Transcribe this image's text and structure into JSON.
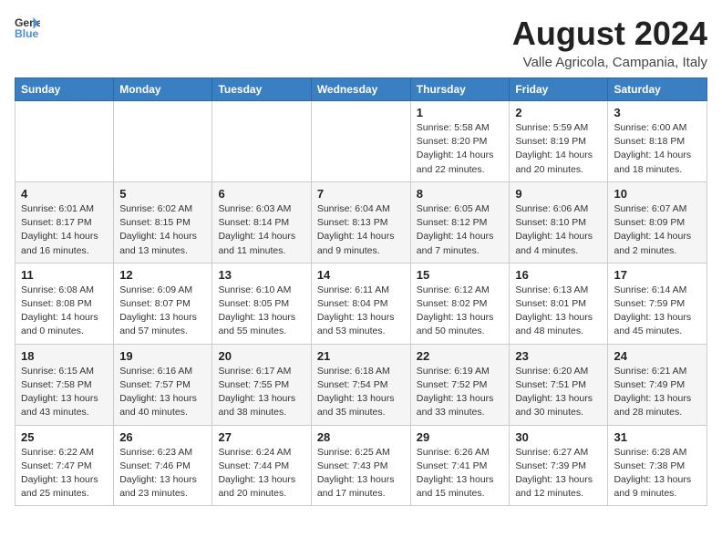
{
  "logo": {
    "line1": "General",
    "line2": "Blue"
  },
  "title": "August 2024",
  "location": "Valle Agricola, Campania, Italy",
  "days_of_week": [
    "Sunday",
    "Monday",
    "Tuesday",
    "Wednesday",
    "Thursday",
    "Friday",
    "Saturday"
  ],
  "weeks": [
    [
      {
        "day": "",
        "info": ""
      },
      {
        "day": "",
        "info": ""
      },
      {
        "day": "",
        "info": ""
      },
      {
        "day": "",
        "info": ""
      },
      {
        "day": "1",
        "info": "Sunrise: 5:58 AM\nSunset: 8:20 PM\nDaylight: 14 hours\nand 22 minutes."
      },
      {
        "day": "2",
        "info": "Sunrise: 5:59 AM\nSunset: 8:19 PM\nDaylight: 14 hours\nand 20 minutes."
      },
      {
        "day": "3",
        "info": "Sunrise: 6:00 AM\nSunset: 8:18 PM\nDaylight: 14 hours\nand 18 minutes."
      }
    ],
    [
      {
        "day": "4",
        "info": "Sunrise: 6:01 AM\nSunset: 8:17 PM\nDaylight: 14 hours\nand 16 minutes."
      },
      {
        "day": "5",
        "info": "Sunrise: 6:02 AM\nSunset: 8:15 PM\nDaylight: 14 hours\nand 13 minutes."
      },
      {
        "day": "6",
        "info": "Sunrise: 6:03 AM\nSunset: 8:14 PM\nDaylight: 14 hours\nand 11 minutes."
      },
      {
        "day": "7",
        "info": "Sunrise: 6:04 AM\nSunset: 8:13 PM\nDaylight: 14 hours\nand 9 minutes."
      },
      {
        "day": "8",
        "info": "Sunrise: 6:05 AM\nSunset: 8:12 PM\nDaylight: 14 hours\nand 7 minutes."
      },
      {
        "day": "9",
        "info": "Sunrise: 6:06 AM\nSunset: 8:10 PM\nDaylight: 14 hours\nand 4 minutes."
      },
      {
        "day": "10",
        "info": "Sunrise: 6:07 AM\nSunset: 8:09 PM\nDaylight: 14 hours\nand 2 minutes."
      }
    ],
    [
      {
        "day": "11",
        "info": "Sunrise: 6:08 AM\nSunset: 8:08 PM\nDaylight: 14 hours\nand 0 minutes."
      },
      {
        "day": "12",
        "info": "Sunrise: 6:09 AM\nSunset: 8:07 PM\nDaylight: 13 hours\nand 57 minutes."
      },
      {
        "day": "13",
        "info": "Sunrise: 6:10 AM\nSunset: 8:05 PM\nDaylight: 13 hours\nand 55 minutes."
      },
      {
        "day": "14",
        "info": "Sunrise: 6:11 AM\nSunset: 8:04 PM\nDaylight: 13 hours\nand 53 minutes."
      },
      {
        "day": "15",
        "info": "Sunrise: 6:12 AM\nSunset: 8:02 PM\nDaylight: 13 hours\nand 50 minutes."
      },
      {
        "day": "16",
        "info": "Sunrise: 6:13 AM\nSunset: 8:01 PM\nDaylight: 13 hours\nand 48 minutes."
      },
      {
        "day": "17",
        "info": "Sunrise: 6:14 AM\nSunset: 7:59 PM\nDaylight: 13 hours\nand 45 minutes."
      }
    ],
    [
      {
        "day": "18",
        "info": "Sunrise: 6:15 AM\nSunset: 7:58 PM\nDaylight: 13 hours\nand 43 minutes."
      },
      {
        "day": "19",
        "info": "Sunrise: 6:16 AM\nSunset: 7:57 PM\nDaylight: 13 hours\nand 40 minutes."
      },
      {
        "day": "20",
        "info": "Sunrise: 6:17 AM\nSunset: 7:55 PM\nDaylight: 13 hours\nand 38 minutes."
      },
      {
        "day": "21",
        "info": "Sunrise: 6:18 AM\nSunset: 7:54 PM\nDaylight: 13 hours\nand 35 minutes."
      },
      {
        "day": "22",
        "info": "Sunrise: 6:19 AM\nSunset: 7:52 PM\nDaylight: 13 hours\nand 33 minutes."
      },
      {
        "day": "23",
        "info": "Sunrise: 6:20 AM\nSunset: 7:51 PM\nDaylight: 13 hours\nand 30 minutes."
      },
      {
        "day": "24",
        "info": "Sunrise: 6:21 AM\nSunset: 7:49 PM\nDaylight: 13 hours\nand 28 minutes."
      }
    ],
    [
      {
        "day": "25",
        "info": "Sunrise: 6:22 AM\nSunset: 7:47 PM\nDaylight: 13 hours\nand 25 minutes."
      },
      {
        "day": "26",
        "info": "Sunrise: 6:23 AM\nSunset: 7:46 PM\nDaylight: 13 hours\nand 23 minutes."
      },
      {
        "day": "27",
        "info": "Sunrise: 6:24 AM\nSunset: 7:44 PM\nDaylight: 13 hours\nand 20 minutes."
      },
      {
        "day": "28",
        "info": "Sunrise: 6:25 AM\nSunset: 7:43 PM\nDaylight: 13 hours\nand 17 minutes."
      },
      {
        "day": "29",
        "info": "Sunrise: 6:26 AM\nSunset: 7:41 PM\nDaylight: 13 hours\nand 15 minutes."
      },
      {
        "day": "30",
        "info": "Sunrise: 6:27 AM\nSunset: 7:39 PM\nDaylight: 13 hours\nand 12 minutes."
      },
      {
        "day": "31",
        "info": "Sunrise: 6:28 AM\nSunset: 7:38 PM\nDaylight: 13 hours\nand 9 minutes."
      }
    ]
  ]
}
